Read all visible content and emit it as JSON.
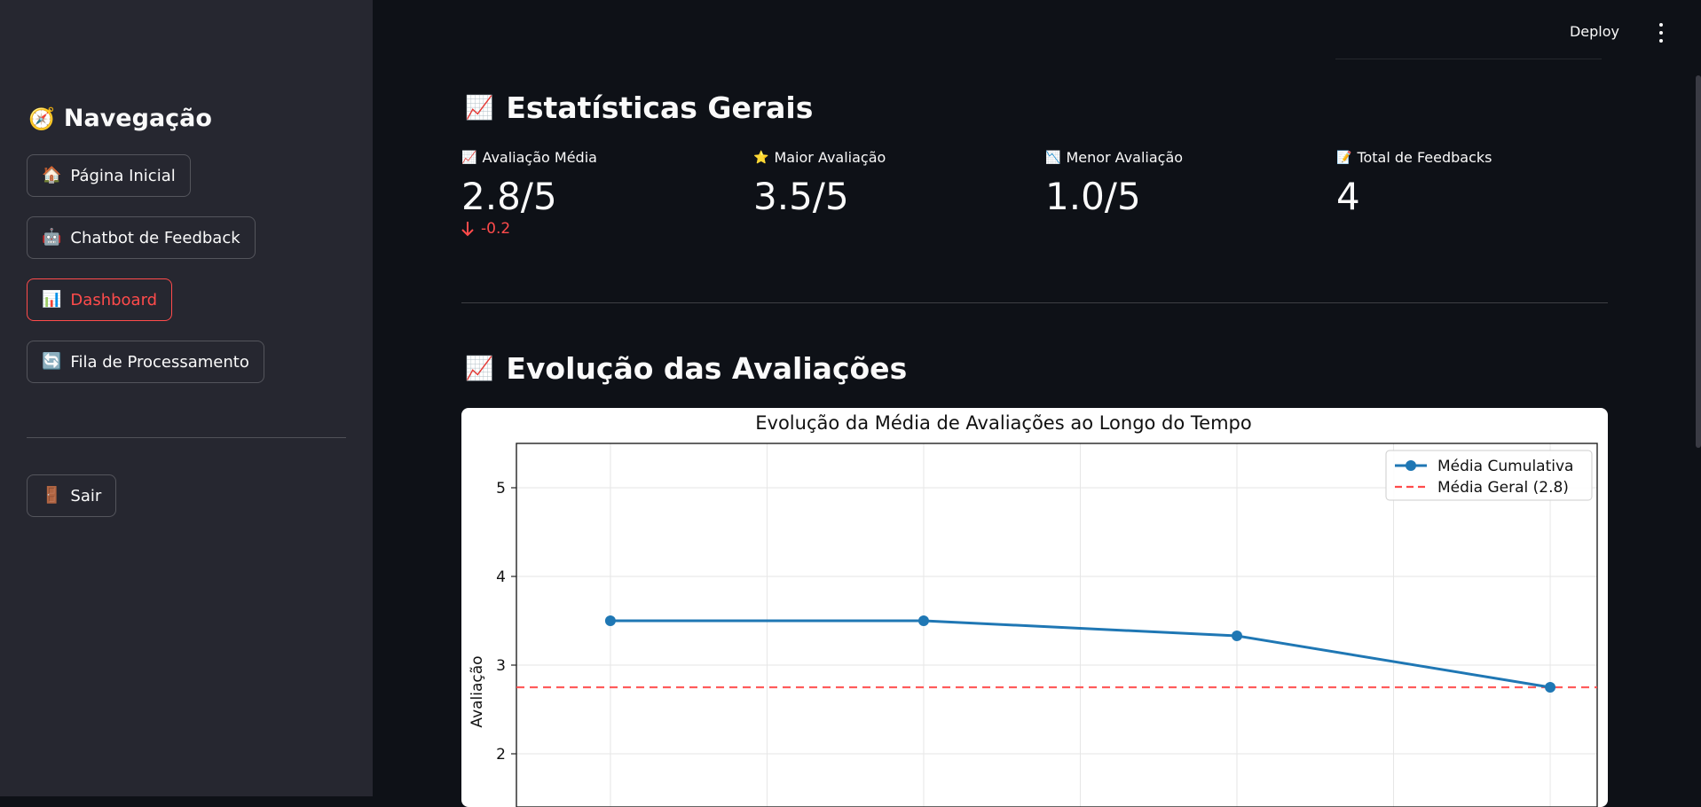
{
  "sidebar": {
    "title": "Navegação",
    "title_icon": "compass-icon",
    "items": [
      {
        "label": "Página Inicial",
        "icon": "house-icon",
        "active": false
      },
      {
        "label": "Chatbot de Feedback",
        "icon": "robot-icon",
        "active": false
      },
      {
        "label": "Dashboard",
        "icon": "bar-chart-icon",
        "active": true
      },
      {
        "label": "Fila de Processamento",
        "icon": "refresh-icon",
        "active": false
      }
    ],
    "logout_label": "Sair",
    "logout_icon": "door-icon"
  },
  "header": {
    "deploy_label": "Deploy",
    "menu_icon": "kebab-menu-icon"
  },
  "stats": {
    "title": "Estatísticas Gerais",
    "title_icon": "chart-increasing-icon",
    "metrics": [
      {
        "label": "Avaliação Média",
        "icon": "chart-increasing-icon",
        "value": "2.8/5",
        "delta": "-0.2",
        "delta_icon": "arrow-down-icon"
      },
      {
        "label": "Maior Avaliação",
        "icon": "star-icon",
        "value": "3.5/5"
      },
      {
        "label": "Menor Avaliação",
        "icon": "chart-decreasing-icon",
        "value": "1.0/5"
      },
      {
        "label": "Total de Feedbacks",
        "icon": "memo-icon",
        "value": "4"
      }
    ]
  },
  "evolution": {
    "title": "Evolução das Avaliações",
    "title_icon": "chart-increasing-icon"
  },
  "colors": {
    "accent": "#ff4b4b",
    "line": "#1f77b4",
    "mean_line": "#ff4b4b"
  },
  "chart_data": {
    "type": "line",
    "title": "Evolução da Média de Avaliações ao Longo do Tempo",
    "ylabel": "Avaliação",
    "xlabel": "",
    "x": [
      1,
      2,
      3,
      4
    ],
    "series": [
      {
        "name": "Média Cumulativa",
        "values": [
          3.5,
          3.5,
          3.33,
          2.75
        ]
      }
    ],
    "reference_line": {
      "name": "Média Geral (2.8)",
      "value": 2.75
    },
    "yticks": [
      2,
      3,
      4,
      5
    ],
    "ylim": [
      1.4,
      5.5
    ],
    "grid": true,
    "legend": "top-right"
  }
}
